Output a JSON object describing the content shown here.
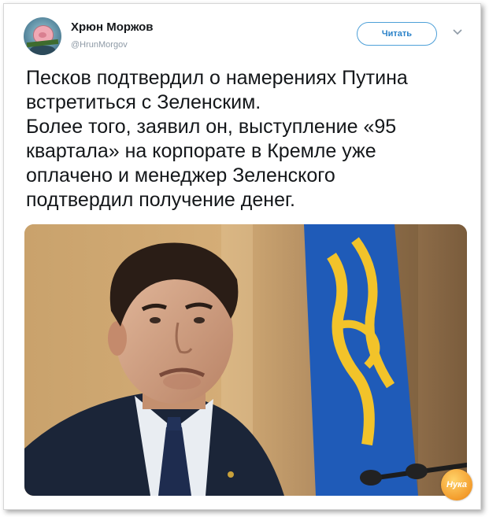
{
  "author": {
    "name": "Хрюн Моржов",
    "handle": "@HrunMorgov",
    "avatar_icon": "pig-avatar-icon"
  },
  "follow_button": {
    "label": "Читать"
  },
  "menu_icon": "chevron-down-icon",
  "tweet": {
    "lines": [
      "Песков подтвердил о намерениях Путина",
      "встретиться с Зеленским.",
      "Более того, заявил он, выступление «95",
      "квартала» на корпорате в Кремле уже",
      "оплачено и менеджер Зеленского",
      "подтвердил получение денег."
    ]
  },
  "photo": {
    "description_icon": "photo-man-frowning-flag-icon"
  },
  "watermark": {
    "text": "Нука"
  },
  "colors": {
    "accent": "#2a82c9",
    "text": "#14171a",
    "muted": "#8e9aa6",
    "flag_blue": "#1f5bb8",
    "flag_yellow": "#f2c32a"
  }
}
